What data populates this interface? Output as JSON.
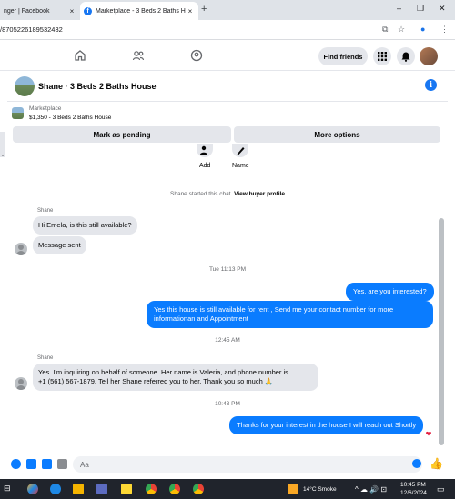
{
  "browser": {
    "tabs": [
      {
        "label": "nger | Facebook",
        "close": "×"
      },
      {
        "label": "Marketplace - 3 Beds 2 Baths H",
        "close": "×"
      }
    ],
    "new_tab": "+",
    "window_controls": {
      "minimize": "–",
      "restore": "❐",
      "close": "✕"
    },
    "url": "/8705226189532432"
  },
  "fb_header": {
    "find_friends": "Find friends"
  },
  "chat": {
    "title": "Shane · 3 Beds 2 Baths House",
    "info": "i",
    "marketplace_label": "Marketplace",
    "marketplace_price": "$1,350 - 3 Beds 2 Baths House",
    "mark_pending": "Mark as pending",
    "more_options": "More options",
    "actions": {
      "add": "Add",
      "name": "Name"
    },
    "started_text": "Shane started this chat.",
    "view_profile": "View buyer profile",
    "messages": {
      "sender1": "Shane",
      "m1": "Hi Emela, is this still available?",
      "m2": "Message sent",
      "time1": "Tue 11:13 PM",
      "m3": "Yes, are you interested?",
      "m4a": "Yes this house is still available for rent , Send me your contact number for more",
      "m4b": "informationan and Appointment",
      "time2": "12:45 AM",
      "sender2": "Shane",
      "m5a": "Yes. I'm inquiring on behalf of someone. Her name is Valeria, and phone number is",
      "m5b": "+1 (561) 567-1879. Tell her Shane referred you to her. Thank you so much 🙏",
      "time3": "10:43 PM",
      "m6": "Thanks for your interest in the house I will reach out Shortly",
      "reaction": "❤"
    },
    "composer_placeholder": "Aa",
    "like": "👍"
  },
  "taskbar": {
    "weather": "14°C  Smoke",
    "time": "10:45 PM",
    "date": "12/6/2024"
  },
  "colors": {
    "accent": "#0a7cff",
    "brand": "#1877f2",
    "bubble_in": "#e4e6eb",
    "taskbar": "#20242c"
  }
}
